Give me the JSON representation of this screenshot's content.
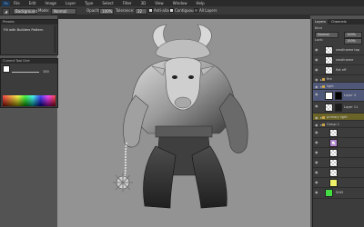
{
  "menu": {
    "logo": "Ps",
    "items": [
      "File",
      "Edit",
      "Image",
      "Layer",
      "Type",
      "Select",
      "Filter",
      "3D",
      "View",
      "Window",
      "Help"
    ]
  },
  "options": {
    "sample_value": "Background",
    "mode_label": "Mode:",
    "mode_value": "Normal",
    "opacity_label": "Opacity:",
    "opacity_value": "100%",
    "tolerance_label": "Tolerance:",
    "tolerance_value": "32",
    "antialias_label": "Anti-alias",
    "contiguous_label": "Contiguous",
    "alllayers_label": "All Layers"
  },
  "presets_panel": {
    "title": "Presets",
    "item": "Fill with Builders Pattern"
  },
  "color_panel": {
    "title": "Current Tool Grid",
    "value": "100"
  },
  "layers_panel": {
    "tabs": [
      "Layers",
      "Channels"
    ],
    "kind_label": "Kind",
    "mode_value": "Normal",
    "opacity_value": "100%",
    "lock_label": "Lock:",
    "fill_value": "100%",
    "layers": [
      {
        "name": "smallname top",
        "kind": "layer",
        "thumb": "checker"
      },
      {
        "name": "smallname",
        "kind": "layer",
        "thumb": "checker"
      },
      {
        "name": "flat eff",
        "kind": "layer",
        "thumb": "checker"
      },
      {
        "name": "fire",
        "kind": "group"
      },
      {
        "name": "light",
        "kind": "group",
        "highlight": "blue"
      },
      {
        "name": "Layer 4",
        "kind": "layer",
        "thumb": "white",
        "mask": "black",
        "highlight": "blue"
      },
      {
        "name": "Layer 11",
        "kind": "layer",
        "thumb": "checker",
        "mask": "dark"
      },
      {
        "name": "primary light",
        "kind": "group",
        "highlight": "yellow"
      },
      {
        "name": "Group 1",
        "kind": "group"
      },
      {
        "name": "",
        "kind": "layer",
        "thumb": "checker"
      },
      {
        "name": "",
        "kind": "layer",
        "thumb": "checker-purple"
      },
      {
        "name": "",
        "kind": "layer",
        "thumb": "checker"
      },
      {
        "name": "",
        "kind": "layer",
        "thumb": "checker"
      },
      {
        "name": "",
        "kind": "layer",
        "thumb": "checker"
      },
      {
        "name": "",
        "kind": "layer",
        "thumb": "checker-yellow"
      },
      {
        "name": "Shift",
        "kind": "layer",
        "thumb": "green"
      }
    ]
  },
  "colors": {
    "swatch_foreground": "#ffffff",
    "swatch_background": "#000000",
    "layer_green": "#44dd44",
    "layer_yellow": "#eef06a",
    "layer_purple": "#b78ad6"
  }
}
